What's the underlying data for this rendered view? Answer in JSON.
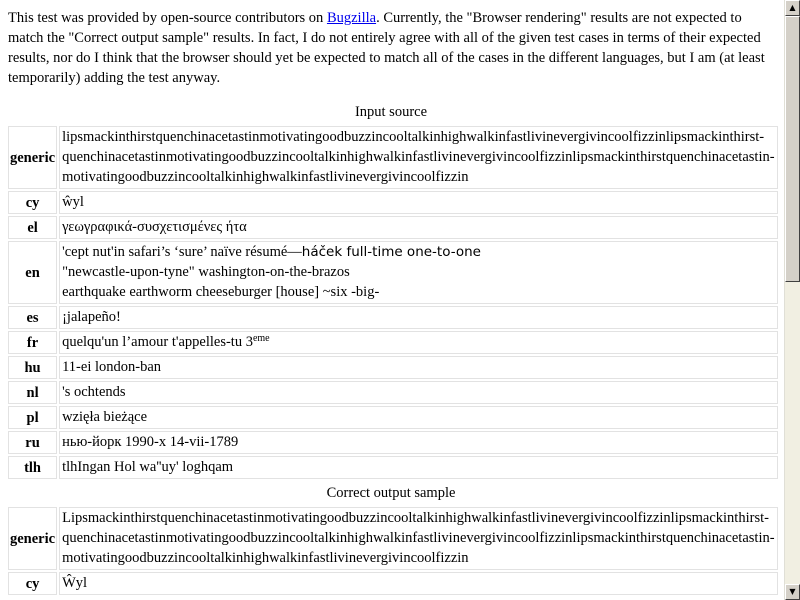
{
  "intro": {
    "before_link": "This test was provided by open-source contributors on ",
    "link_text": "Bugzilla",
    "after_link": ". Currently, the \"Browser rendering\" results are not expected to match the \"Correct output sample\" results. In fact, I do not entirely agree with all of the given test cases in terms of their expected results, nor do I think that the browser should yet be expected to match all of the cases in the different languages, but I am (at least temporarily) adding the test anyway."
  },
  "input_section": {
    "caption": "Input source",
    "rows": {
      "generic": {
        "lang": "generic",
        "line1": "lipsmackinthirstquenchinacetastinmotivatingoodbuzzincooltalkinhighwalkinfastlivinevergivincoolfizzinlipsmackinthirst-",
        "line2": "quenchinacetastinmotivatingoodbuzzincooltalkinhighwalkinfastlivinevergivincoolfizzinlipsmackinthirstquenchinacetastin-",
        "line3": "motivatingoodbuzzincooltalkinhighwalkinfastlivinevergivincoolfizzin"
      },
      "cy": {
        "lang": "cy",
        "text": "ŵyl"
      },
      "el": {
        "lang": "el",
        "text": "γεωγραφικά-συσχετισμένες ήτα"
      },
      "en": {
        "lang": "en",
        "line1_serif": "'cept nut'in safari’s ‘sure’ naïve résumé—",
        "line1_sans": "háček full-time one-to-one",
        "line2": "\"newcastle-upon-tyne\" washington-on-the-brazos",
        "line3": "earthquake earthworm cheeseburger [house] ~six -big-"
      },
      "es": {
        "lang": "es",
        "text": "¡jalapeño!"
      },
      "fr": {
        "lang": "fr",
        "text": "quelqu'un l’amour t'appelles-tu 3",
        "sup": "eme"
      },
      "hu": {
        "lang": "hu",
        "text": "11-ei london-ban"
      },
      "nl": {
        "lang": "nl",
        "text": "'s ochtends"
      },
      "pl": {
        "lang": "pl",
        "text": "wzięła bieżące"
      },
      "ru": {
        "lang": "ru",
        "text": "нью-йорк 1990-х 14-vii-1789"
      },
      "tlh": {
        "lang": "tlh",
        "text": "tlhIngan Hol wa''uy' loghqam"
      }
    }
  },
  "output_section": {
    "caption": "Correct output sample",
    "rows": {
      "generic": {
        "lang": "generic",
        "line1": "Lipsmackinthirstquenchinacetastinmotivatingoodbuzzincooltalkinhighwalkinfastlivinevergivincoolfizzinlipsmackinthirst-",
        "line2": "quenchinacetastinmotivatingoodbuzzincooltalkinhighwalkinfastlivinevergivincoolfizzinlipsmackinthirstquenchinacetastin-",
        "line3": "motivatingoodbuzzincooltalkinhighwalkinfastlivinevergivincoolfizzin"
      },
      "cy": {
        "lang": "cy",
        "text": "Ŵyl"
      }
    }
  },
  "scrollbar": {
    "up_glyph": "▲",
    "down_glyph": "▼",
    "scroll_fraction": 0.0
  }
}
